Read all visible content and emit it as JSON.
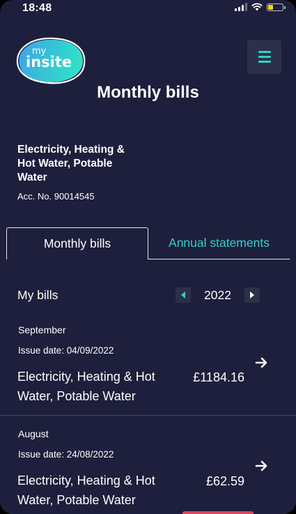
{
  "status_bar": {
    "time": "18:48",
    "icons": [
      "cellular-signal-icon",
      "wifi-icon",
      "battery-low-icon"
    ],
    "battery_color": "#f5d623"
  },
  "header": {
    "logo_text_top": "my",
    "logo_text_main": "insite",
    "menu_icon": "hamburger-menu-icon",
    "title": "Monthly bills"
  },
  "account": {
    "name": "Electricity, Heating & Hot Water, Potable Water",
    "number": "Acc. No. 90014545"
  },
  "tabs": {
    "active_label": "Monthly bills",
    "inactive_label": "Annual statements"
  },
  "bills_section": {
    "label": "My bills",
    "year": "2022",
    "prev_icon": "chevron-left-icon",
    "next_icon": "chevron-right-icon"
  },
  "bills": [
    {
      "month": "September",
      "issue_date": "Issue date: 04/09/2022",
      "description": "Electricity, Heating & Hot Water, Potable Water",
      "amount": "£1184.16"
    },
    {
      "month": "August",
      "issue_date": "Issue date: 24/08/2022",
      "description": "Electricity, Heating & Hot Water, Potable Water",
      "amount": "£62.59"
    }
  ],
  "colors": {
    "background": "#1d1f3c",
    "accent_teal": "#2dd3c8",
    "accent_red": "#e0455c"
  }
}
